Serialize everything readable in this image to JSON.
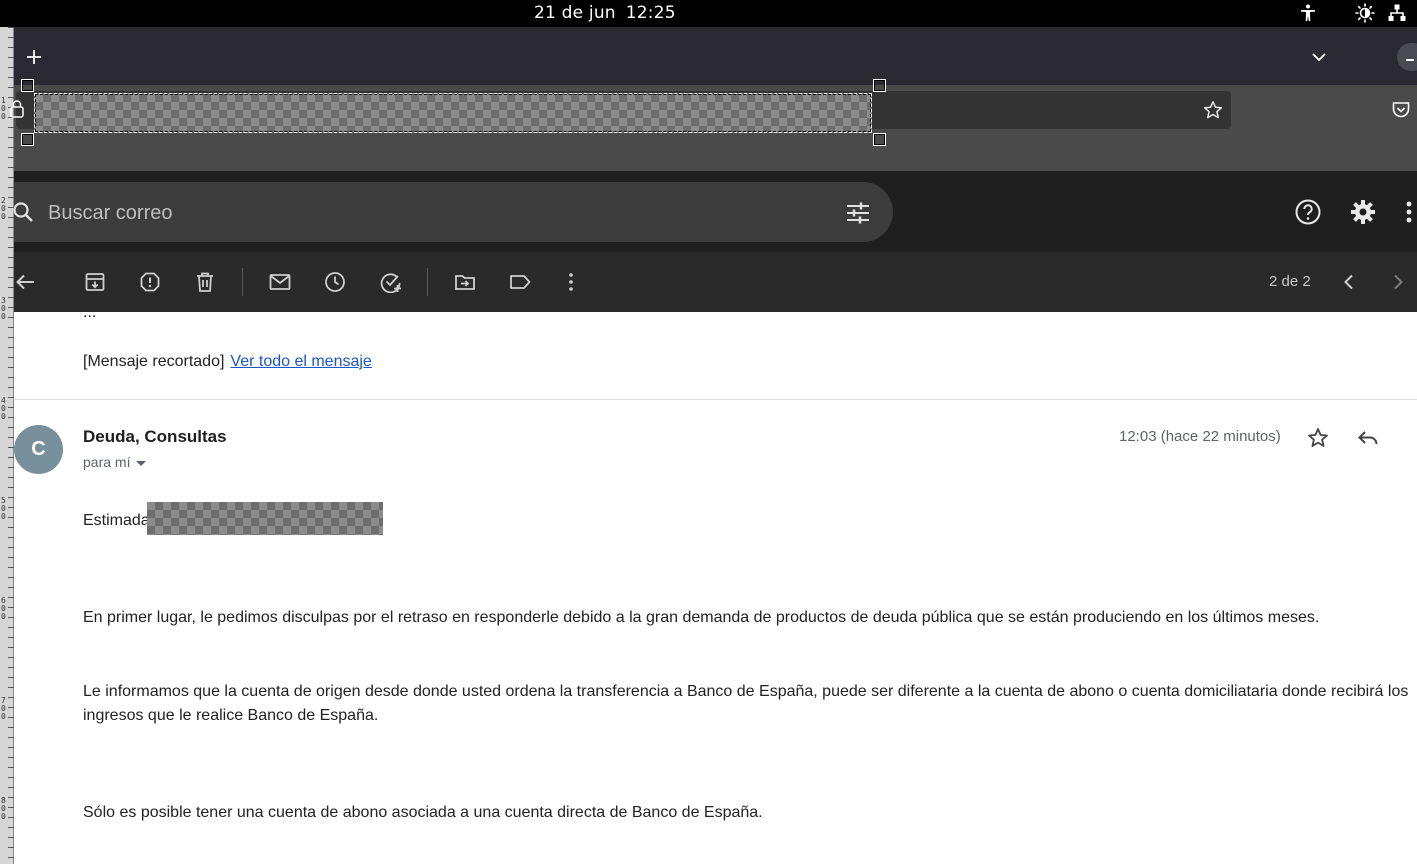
{
  "system": {
    "date": "21 de jun",
    "time": "12:25"
  },
  "ruler": {
    "labels": [
      "1\n0\n0",
      "2\n0\n0",
      "3\n0\n0",
      "4\n0\n0",
      "5\n0\n0",
      "6\n0\n0",
      "7\n0\n0",
      "8\n0\n0"
    ]
  },
  "browser": {
    "new_tab": "+"
  },
  "search": {
    "placeholder": "Buscar correo"
  },
  "toolbar": {
    "pager": "2 de 2"
  },
  "thread": {
    "ellipsis": "...",
    "clipped_notice": "[Mensaje recortado]",
    "view_full_link": "Ver todo el mensaje"
  },
  "message": {
    "avatar_letter": "C",
    "sender": "Deuda, Consultas",
    "to": "para mí",
    "timestamp": "12:03 (hace 22 minutos)",
    "greeting": "Estimada",
    "paragraph1": "En primer lugar, le pedimos disculpas por el retraso en responderle debido a la gran demanda de productos de deuda pública que se están produciendo en los últimos meses.",
    "paragraph2_line1": "Le informamos que la cuenta de origen desde donde usted ordena la transferencia a Banco de España, puede ser diferente a la cuenta de abono o cuenta domiciliataria donde recibirá los",
    "paragraph2_line2": "ingresos que le realice Banco de España.",
    "paragraph3": "Sólo es posible tener una cuenta de abono asociada a una cuenta directa de Banco de España."
  },
  "colors": {
    "link": "#1a56c9",
    "avatar": "#78909c",
    "toolbar_bg": "#2a2a2a",
    "header_bg": "#1f1f1f"
  },
  "icons": [
    "accessibility-icon",
    "brightness-icon",
    "network-icon",
    "plus-icon",
    "chevron-down-icon",
    "lock-icon",
    "star-icon",
    "pocket-icon",
    "search-icon",
    "filter-icon",
    "help-icon",
    "settings-icon",
    "more-vert-icon",
    "back-arrow-icon",
    "archive-icon",
    "report-spam-icon",
    "delete-icon",
    "mark-unread-icon",
    "snooze-icon",
    "add-task-icon",
    "move-to-icon",
    "label-icon",
    "more-icon",
    "prev-icon",
    "next-icon",
    "reply-icon"
  ]
}
